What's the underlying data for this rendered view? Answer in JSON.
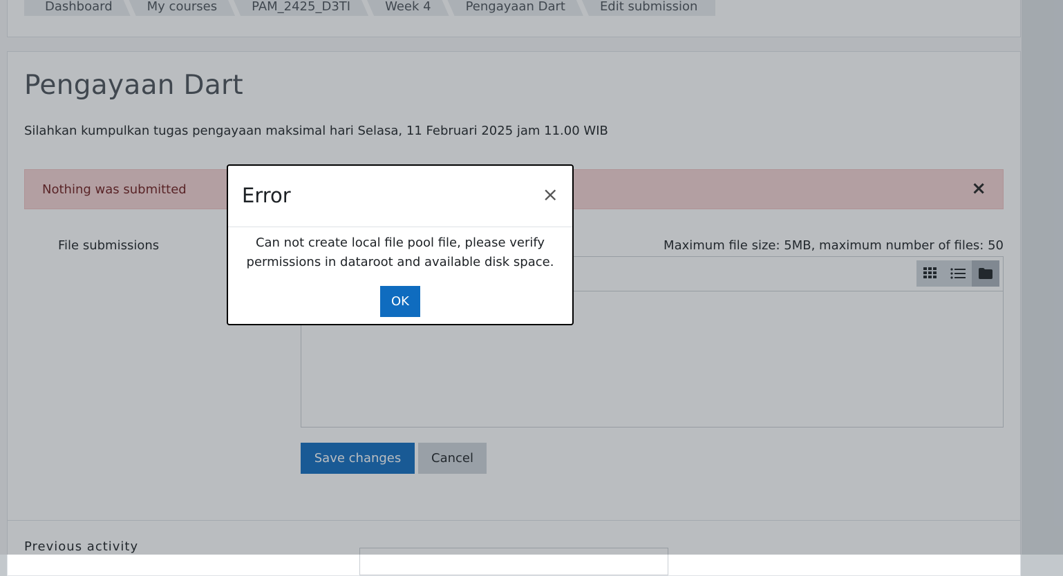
{
  "breadcrumb": [
    "Dashboard",
    "My courses",
    "PAM_2425_D3TI",
    "Week 4",
    "Pengayaan Dart",
    "Edit submission"
  ],
  "page": {
    "title": "Pengayaan Dart",
    "intro": "Silahkan kumpulkan tugas pengayaan maksimal hari Selasa, 11 Februari 2025 jam 11.00 WIB"
  },
  "alert": {
    "text": "Nothing was submitted",
    "close_glyph": "×"
  },
  "form": {
    "file_submissions_label": "File submissions",
    "max_info": "Maximum file size: 5MB, maximum number of files: 50",
    "view_icons": [
      "grid-icon",
      "list-icon",
      "folder-icon"
    ],
    "save_label": "Save changes",
    "cancel_label": "Cancel"
  },
  "footer": {
    "previous_activity_label": "Previous activity"
  },
  "modal": {
    "title": "Error",
    "close_glyph": "×",
    "message": "Can not create local file pool file, please verify permissions in dataroot and available disk space.",
    "ok_label": "OK"
  },
  "colors": {
    "primary": "#0f6cbf",
    "alert_bg": "#f5d2d2",
    "alert_text": "#6e1a1a"
  }
}
